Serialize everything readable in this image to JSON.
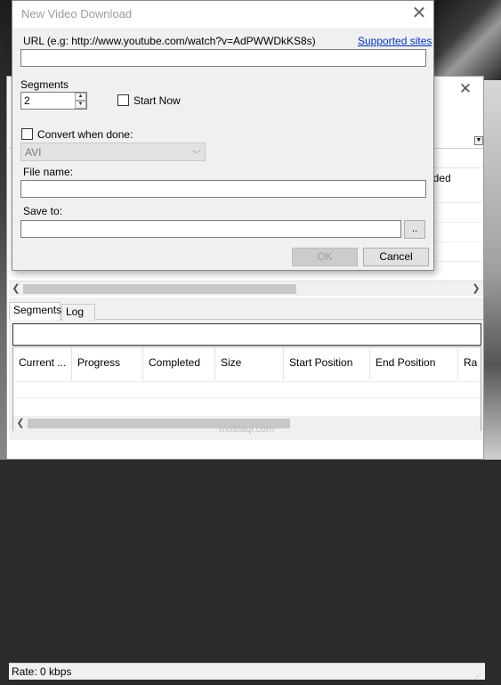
{
  "dialog": {
    "title": "New Video Download",
    "url_label": "URL (e.g: http://www.youtube.com/watch?v=AdPWWDkKS8s)",
    "supported_sites_link": "Supported sites",
    "url_value": "",
    "segments_label": "Segments",
    "segments_value": "2",
    "start_now_label": "Start Now",
    "start_now_checked": false,
    "convert_label": "Convert when done:",
    "convert_checked": false,
    "format_selected": "AVI",
    "file_name_label": "File name:",
    "file_name_value": "",
    "save_to_label": "Save to:",
    "save_to_value": "",
    "browse_label": "..",
    "ok_label": "OK",
    "cancel_label": "Cancel"
  },
  "main": {
    "grid_added_header": "dded",
    "tabs": [
      {
        "label": "Segments"
      },
      {
        "label": "Log"
      }
    ],
    "segment_columns": [
      "Current ...",
      "Progress",
      "Completed",
      "Size",
      "Start Position",
      "End Position",
      "Ra"
    ],
    "status_text": "Rate:  0 kbps"
  },
  "watermark": "mostaql.com",
  "icons": {
    "close": "close-icon",
    "spin_up": "spin-up-icon",
    "spin_down": "spin-down-icon",
    "dropdown": "chevron-down-icon",
    "scroll_left": "chevron-left-icon",
    "scroll_right": "chevron-right-icon"
  }
}
